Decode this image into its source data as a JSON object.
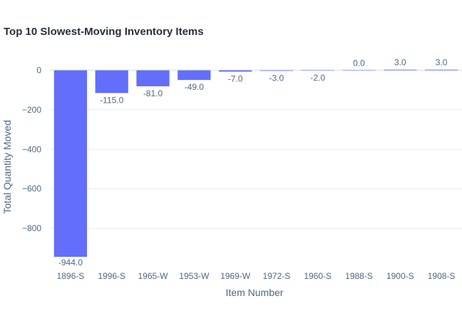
{
  "chart_data": {
    "type": "bar",
    "title": "Top 10 Slowest-Moving Inventory Items",
    "xlabel": "Item Number",
    "ylabel": "Total Quantity Moved",
    "categories": [
      "1896-S",
      "1996-S",
      "1965-W",
      "1953-W",
      "1969-W",
      "1972-S",
      "1960-S",
      "1988-S",
      "1900-S",
      "1908-S"
    ],
    "values": [
      -944,
      -115,
      -81,
      -49,
      -7,
      -3,
      -2,
      0,
      3,
      3
    ],
    "data_labels": [
      "-944.0",
      "-115.0",
      "-81.0",
      "-49.0",
      "-7.0",
      "-3.0",
      "-2.0",
      "0.0",
      "3.0",
      "3.0"
    ],
    "y_ticks": [
      0,
      -200,
      -400,
      -600,
      -800
    ],
    "y_tick_labels": [
      "0",
      "−200",
      "−400",
      "−600",
      "−800"
    ],
    "ylim": [
      -980,
      38
    ],
    "grid": true,
    "bar_color": "#636efa",
    "gridline_color": "#e8ebf0",
    "text_color": "#506784"
  }
}
